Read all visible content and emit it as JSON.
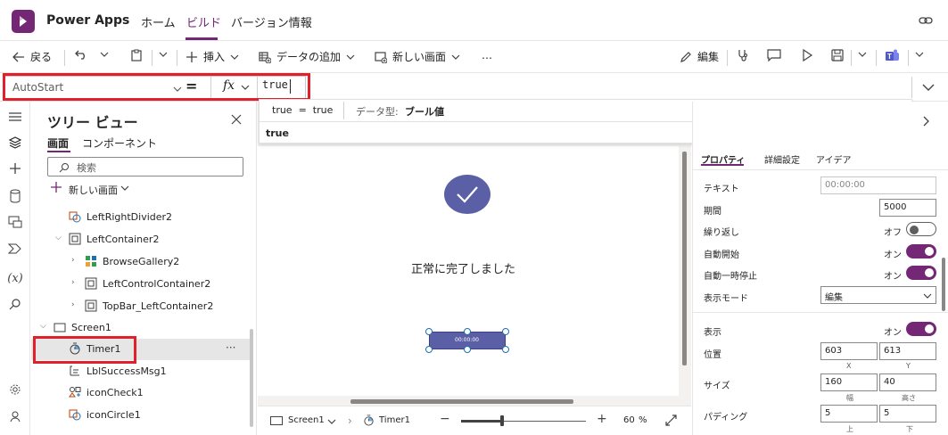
{
  "app": {
    "name": "Power Apps"
  },
  "nav": {
    "home": "ホーム",
    "build": "ビルド",
    "versions": "バージョン情報"
  },
  "toolbar": {
    "back": "戻る",
    "insert": "挿入",
    "add_data": "データの追加",
    "new_screen": "新しい画面",
    "more": "…",
    "edit": "編集"
  },
  "formula": {
    "property": "AutoStart",
    "equals": "=",
    "fx": "fx",
    "value": "true"
  },
  "autocomplete": {
    "expr": "true  =  true",
    "type_label": "データ型:",
    "type_value": "ブール値",
    "suggestion": "true"
  },
  "tree": {
    "title": "ツリー ビュー",
    "tabs": [
      "画面",
      "コンポーネント"
    ],
    "search_placeholder": "検索",
    "new_screen": "新しい画面",
    "items": [
      "LeftRightDivider2",
      "LeftContainer2",
      "BrowseGallery2",
      "LeftControlContainer2",
      "TopBar_LeftContainer2",
      "Screen1",
      "Timer1",
      "LblSuccessMsg1",
      "iconCheck1",
      "iconCircle1"
    ],
    "more": "···"
  },
  "canvas": {
    "success_msg": "正常に完了しました",
    "timer_text": "00:00:00"
  },
  "status": {
    "screen": "Screen1",
    "control": "Timer1",
    "zoom": "60",
    "zoom_unit": "%"
  },
  "props": {
    "tabs": [
      "プロパティ",
      "詳細設定",
      "アイデア"
    ],
    "text_label": "テキスト",
    "text_value": "00:00:00",
    "duration_label": "期間",
    "duration_value": "5000",
    "repeat_label": "繰り返し",
    "repeat_state": "オフ",
    "autostart_label": "自動開始",
    "autostart_state": "オン",
    "autopause_label": "自動一時停止",
    "autopause_state": "オン",
    "display_mode_label": "表示モード",
    "display_mode_value": "編集",
    "visible_label": "表示",
    "visible_state": "オン",
    "position_label": "位置",
    "pos_x": "603",
    "pos_y": "613",
    "pos_x_label": "X",
    "pos_y_label": "Y",
    "size_label": "サイズ",
    "width": "160",
    "height": "40",
    "width_label": "幅",
    "height_label": "高さ",
    "padding_label": "パディング",
    "pad_top": "5",
    "pad_bottom": "5",
    "pad_top_label": "上",
    "pad_bottom_label": "下"
  },
  "colors": {
    "accent": "#742774",
    "highlight": "#e0202a",
    "check_circle": "#5b5fa6"
  }
}
